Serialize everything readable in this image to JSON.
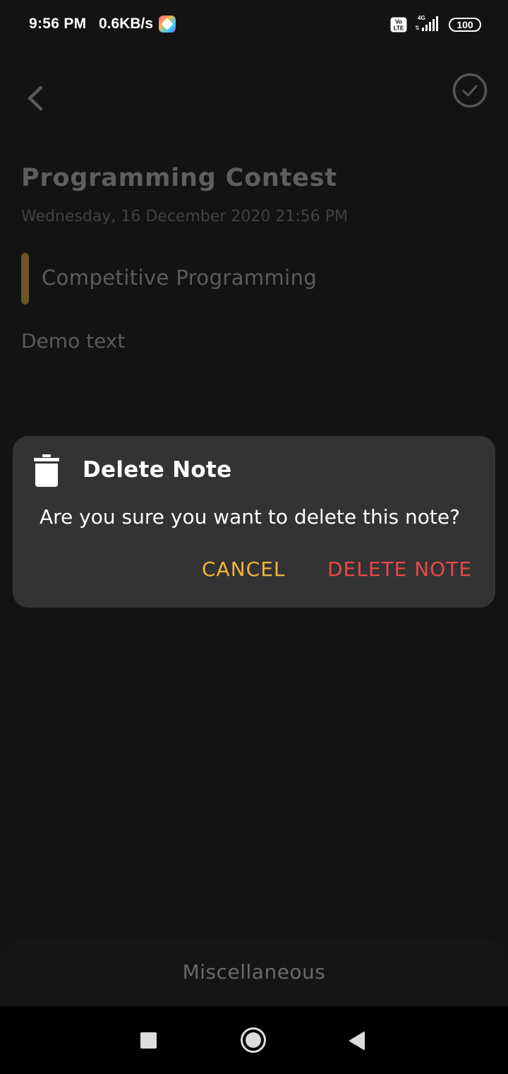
{
  "status_bar": {
    "time": "9:56 PM",
    "net_speed": "0.6KB/s",
    "network_type": "4G",
    "volte": "Vo LTE",
    "battery": "100"
  },
  "toolbar": {
    "back_icon": "chevron-left-icon",
    "save_icon": "check-circle-icon"
  },
  "note": {
    "title": "Programming Contest",
    "date": "Wednesday, 16 December 2020 21:56 PM",
    "subtitle": "Competitive Programming",
    "subtitle_indicator_color": "#6a5620",
    "body": "Demo text"
  },
  "dialog": {
    "icon": "trash-icon",
    "title": "Delete Note",
    "message": "Are you sure you want to delete this note?",
    "cancel_label": "CANCEL",
    "delete_label": "DELETE NOTE",
    "cancel_color": "#f2b43b",
    "delete_color": "#e9474a"
  },
  "bottom_sheet": {
    "label": "Miscellaneous"
  },
  "nav_bar": {
    "recents_icon": "square-icon",
    "home_icon": "circle-icon",
    "back_icon": "triangle-back-icon"
  }
}
